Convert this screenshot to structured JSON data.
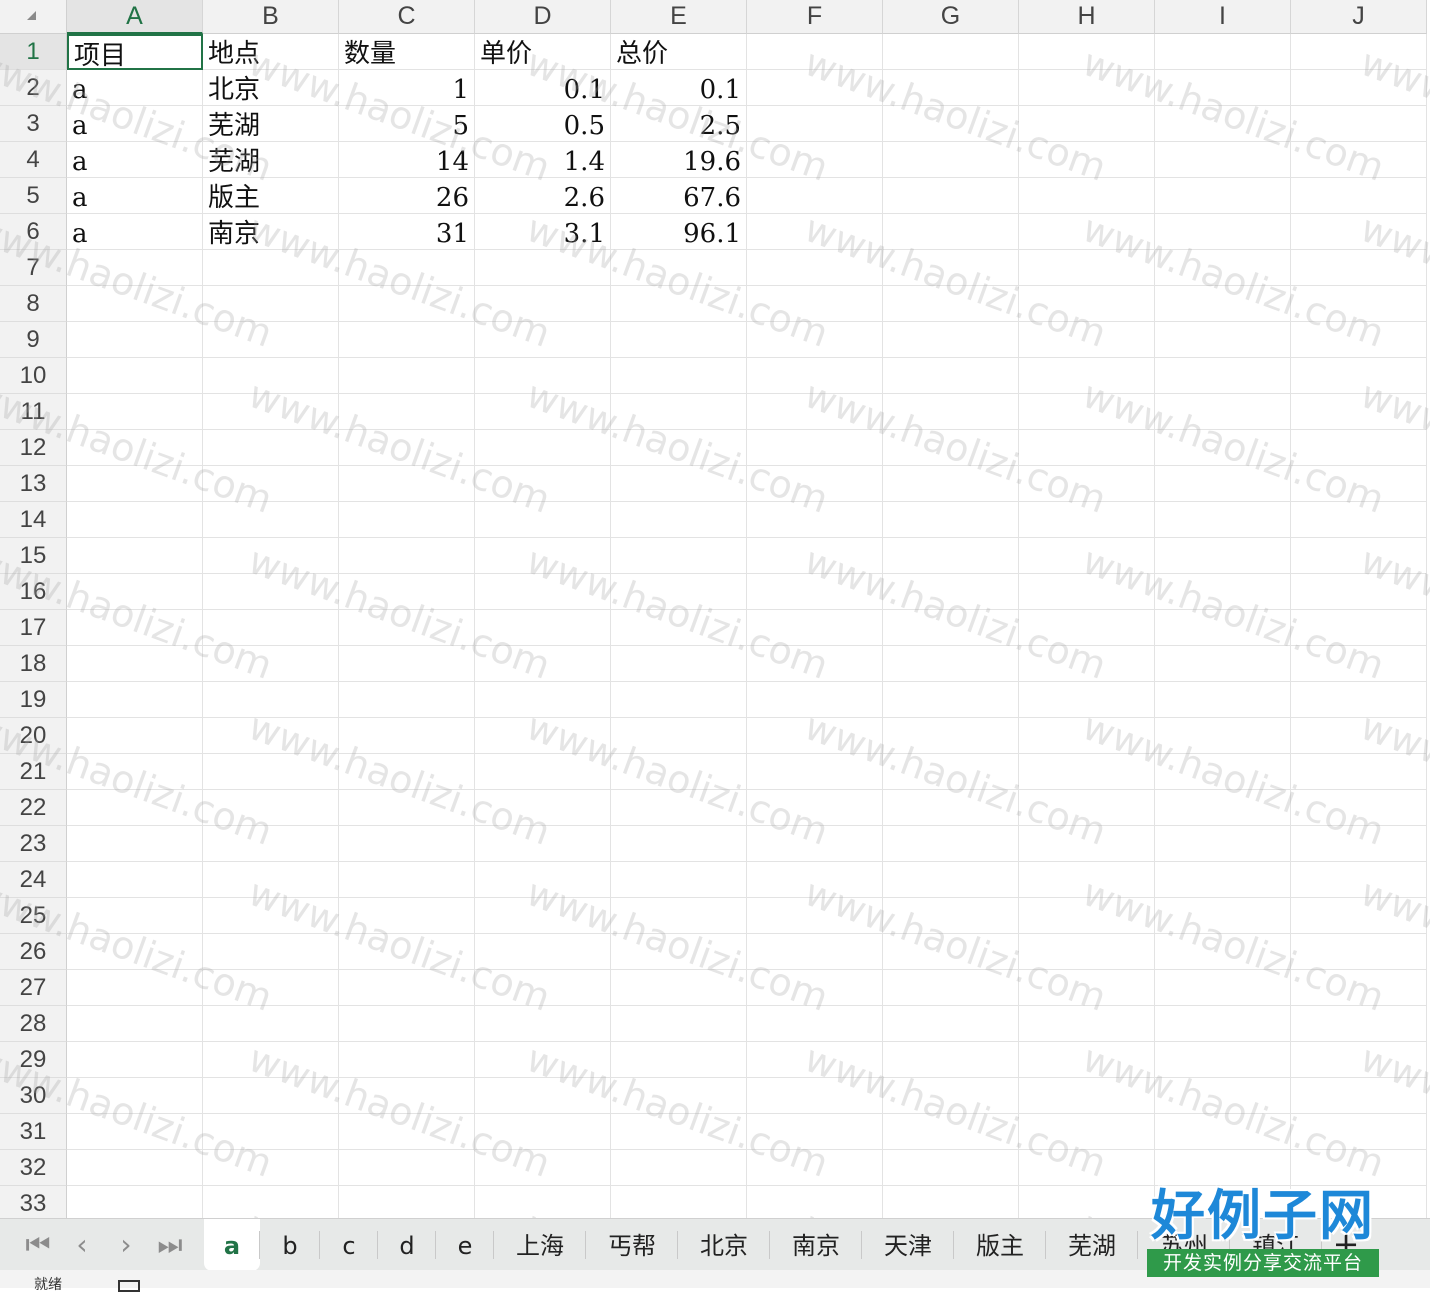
{
  "columns": [
    "A",
    "B",
    "C",
    "D",
    "E",
    "F",
    "G",
    "H",
    "I",
    "J"
  ],
  "active_column": "A",
  "active_row": 1,
  "rows": [
    [
      "项目",
      "地点",
      "数量",
      "单价",
      "总价"
    ],
    [
      "a",
      "北京",
      "1",
      "0.1",
      "0.1"
    ],
    [
      "a",
      "芜湖",
      "5",
      "0.5",
      "2.5"
    ],
    [
      "a",
      "芜湖",
      "14",
      "1.4",
      "19.6"
    ],
    [
      "a",
      "版主",
      "26",
      "2.6",
      "67.6"
    ],
    [
      "a",
      "南京",
      "31",
      "3.1",
      "96.1"
    ]
  ],
  "row_numbers": [
    "1",
    "2",
    "3",
    "4",
    "5",
    "6",
    "7",
    "8",
    "9",
    "10",
    "11",
    "12",
    "13",
    "14",
    "15",
    "16",
    "17",
    "18",
    "19",
    "20",
    "21",
    "22",
    "23",
    "24",
    "25",
    "26",
    "27",
    "28",
    "29",
    "30",
    "31",
    "32",
    "33"
  ],
  "watermark_text": "www.haolizi.com",
  "sheet_nav": {
    "first_icon": "first-sheet-icon",
    "prev_icon": "prev-sheet-icon",
    "next_icon": "next-sheet-icon",
    "last_icon": "last-sheet-icon"
  },
  "sheet_tabs": [
    "a",
    "b",
    "c",
    "d",
    "e",
    "上海",
    "丐帮",
    "北京",
    "南京",
    "天津",
    "版主",
    "芜湖",
    "苏州",
    "镇江"
  ],
  "active_sheet": "a",
  "add_sheet_label": "+",
  "logo": {
    "title": "好例子网",
    "subtitle": "开发实例分享交流平台"
  },
  "status": {
    "text": "就绪"
  },
  "colors": {
    "accent": "#217346",
    "logo_blue": "#1e88d8",
    "logo_green": "#2f9a4a"
  }
}
